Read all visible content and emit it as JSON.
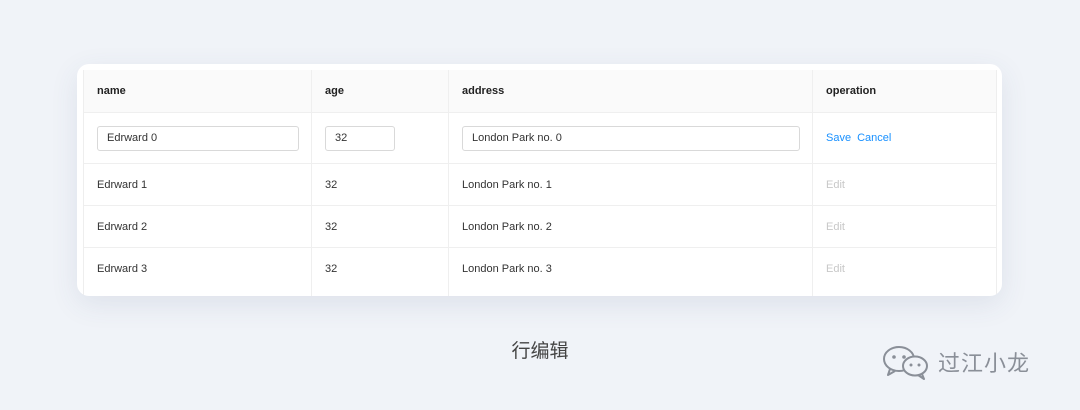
{
  "table": {
    "columns": [
      "name",
      "age",
      "address",
      "operation"
    ],
    "editing_row": {
      "name": "Edrward 0",
      "age": "32",
      "address": "London Park no. 0",
      "actions": [
        "Save",
        "Cancel"
      ]
    },
    "rows": [
      {
        "name": "Edrward 1",
        "age": "32",
        "address": "London Park no. 1",
        "action": "Edit"
      },
      {
        "name": "Edrward 2",
        "age": "32",
        "address": "London Park no. 2",
        "action": "Edit"
      },
      {
        "name": "Edrward 3",
        "age": "32",
        "address": "London Park no. 3",
        "action": "Edit"
      }
    ],
    "partial_row": {
      "name": "",
      "age": "",
      "address": "",
      "action": ""
    }
  },
  "caption": "行编辑",
  "watermark": {
    "icon": "wechat-icon",
    "text": "过江小龙"
  },
  "colors": {
    "accent": "#1890ff",
    "disabled": "#c8c8c8",
    "background": "#f0f3f8"
  }
}
